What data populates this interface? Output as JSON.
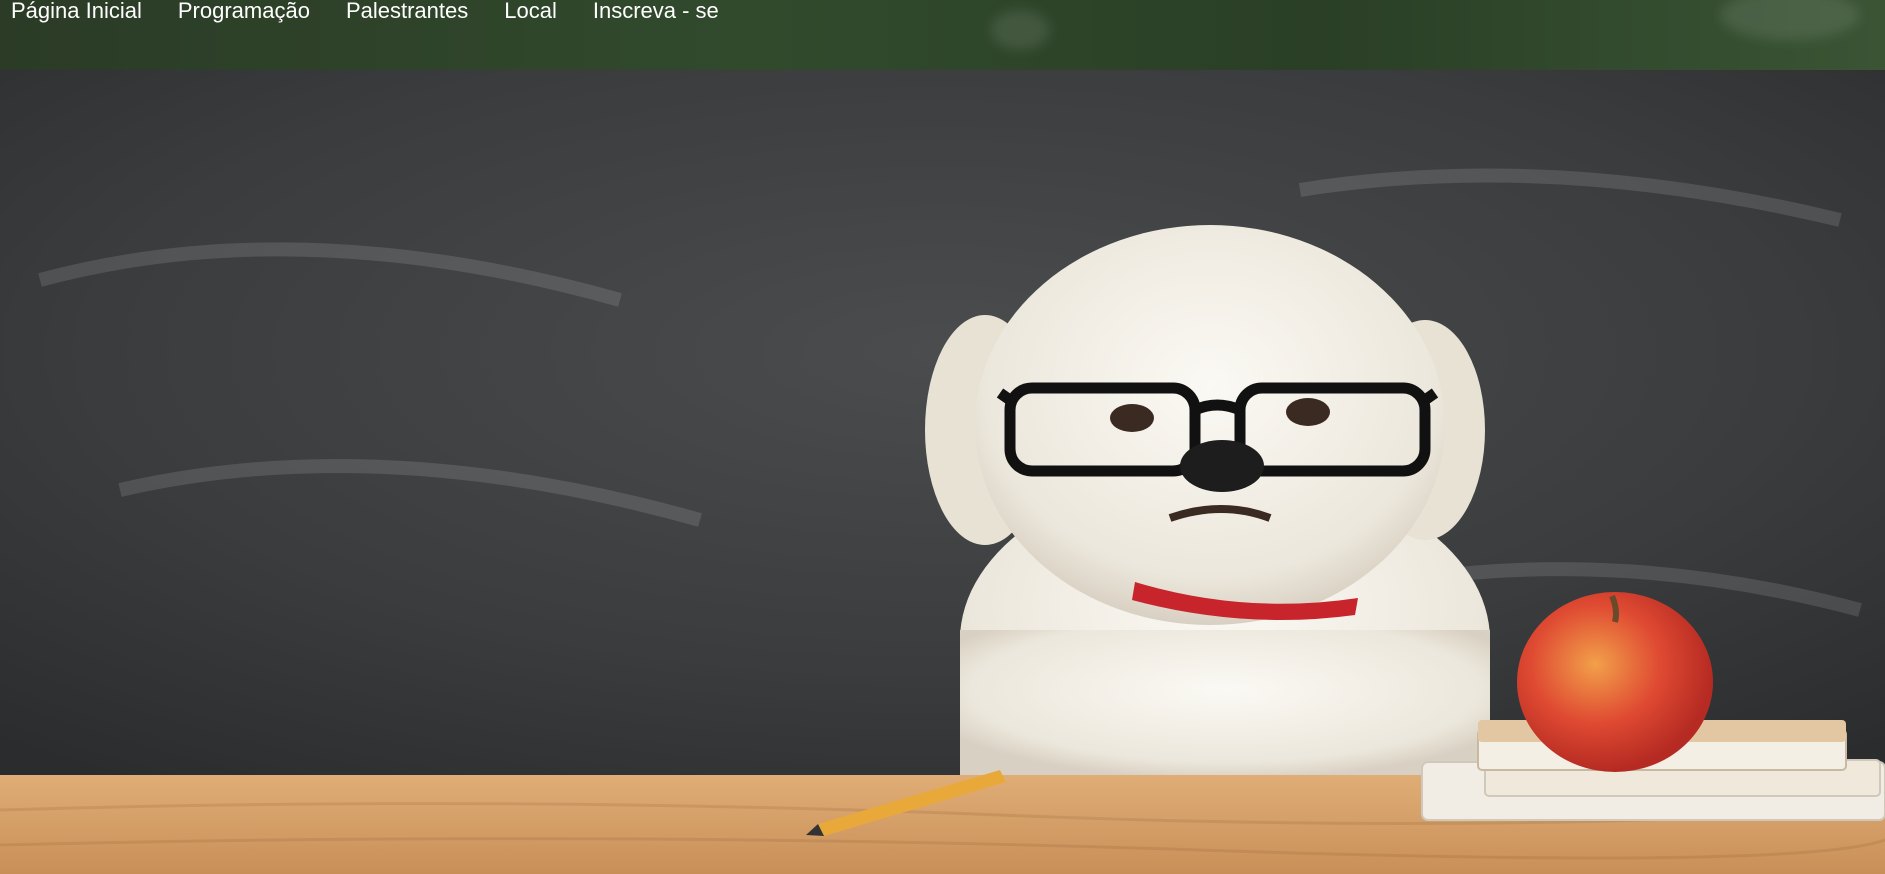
{
  "nav": {
    "items": [
      {
        "label": "Página Inicial"
      },
      {
        "label": "Programação"
      },
      {
        "label": "Palestrantes"
      },
      {
        "label": "Local"
      },
      {
        "label": "Inscreva - se"
      }
    ]
  },
  "hero": {
    "image": "dog-with-glasses-at-chalkboard",
    "colors": {
      "chalkboard": "#3a3c3d",
      "desk": "#d9a56e",
      "dog": "#f2efe8",
      "collar": "#c8242c",
      "apple": "#d83a2e"
    }
  },
  "theme": {
    "nav_bg": "#2f4529",
    "nav_text": "#ffffff"
  }
}
